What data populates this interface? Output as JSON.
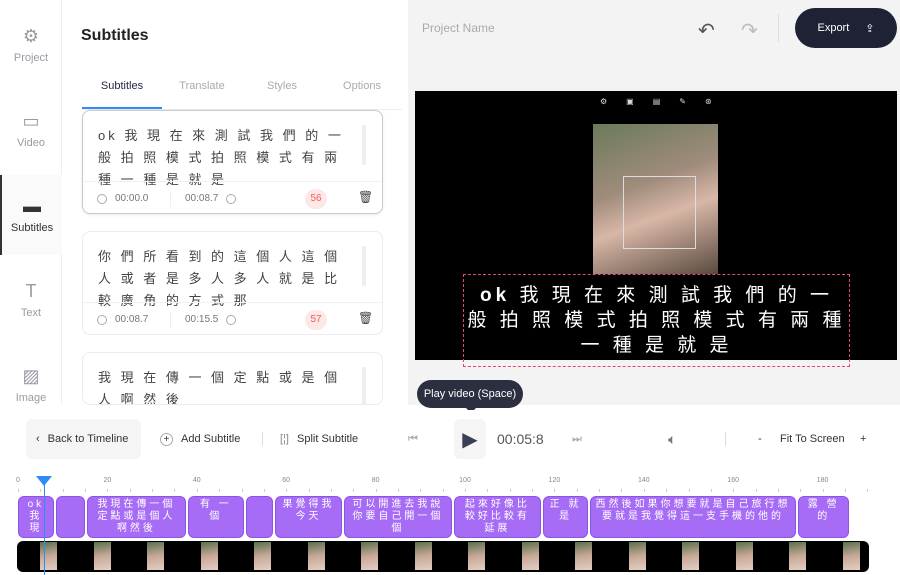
{
  "sidebar": {
    "items": [
      {
        "label": "Project",
        "icon": "gear-icon"
      },
      {
        "label": "Video",
        "icon": "video-icon"
      },
      {
        "label": "Subtitles",
        "icon": "subtitles-icon",
        "active": true
      },
      {
        "label": "Text",
        "icon": "text-icon"
      },
      {
        "label": "Image",
        "icon": "image-icon"
      }
    ]
  },
  "panel": {
    "title": "Subtitles",
    "tabs": [
      "Subtitles",
      "Translate",
      "Styles",
      "Options"
    ],
    "cards": [
      {
        "text": "ok 我 現 在 來 測 試 我 們 的 一 般 拍 照 模 式 拍 照 模 式 有 兩 種 一 種 是 就 是",
        "start": "00:00.0",
        "end": "00:08.7",
        "count": "56"
      },
      {
        "text": "你 們 所 看 到 的 這 個 人 這 個 人 或 者 是 多 人 多 人 就 是 比 較 廣 角 的 方 式 那",
        "start": "00:08.7",
        "end": "00:15.5",
        "count": "57"
      },
      {
        "text": "我 現 在 傳 一 個 定 點 或 是 個 人 啊 然 後",
        "start": "",
        "end": "",
        "count": ""
      }
    ]
  },
  "header": {
    "project_name": "Project Name",
    "export_label": "Export"
  },
  "video": {
    "subtitle_bold": "ok",
    "subtitle": " 我 現 在 來 測 試 我 們 的 一 般 拍 照 模 式 拍 照 模 式 有 兩 種 一 種 是 就 是"
  },
  "tooltip": "Play video (Space)",
  "controls": {
    "back": "Back to Timeline",
    "add": "Add Subtitle",
    "split": "Split Subtitle",
    "time": "00:05:8",
    "zoom_minus": "-",
    "fit": "Fit To Screen",
    "zoom_plus": "+"
  },
  "timeline": {
    "ticks": [
      "0",
      "20",
      "40",
      "60",
      "80",
      "100",
      "120",
      "140",
      "160",
      "180"
    ],
    "playhead": 5.8,
    "blocks": [
      {
        "text": "ok 我 現",
        "start": 0,
        "end": 8
      },
      {
        "text": "",
        "start": 8.5,
        "end": 15
      },
      {
        "text": "我現在傳一個定點或是個人啊然後",
        "start": 15.5,
        "end": 37.5
      },
      {
        "text": "有 一 個",
        "start": 38,
        "end": 50.5
      },
      {
        "text": "",
        "start": 51,
        "end": 57
      },
      {
        "text": "果覺得我今天",
        "start": 57.5,
        "end": 72.5
      },
      {
        "text": "可以開進去我說你要自己開一個個",
        "start": 73,
        "end": 97
      },
      {
        "text": "起來好像比較好比較有延展",
        "start": 97.5,
        "end": 117
      },
      {
        "text": "正 就 是",
        "start": 117.5,
        "end": 127.5
      },
      {
        "text": "西然後如果你想要就是自己旅行想要就是我覺得這一支手機的他的",
        "start": 128,
        "end": 174
      },
      {
        "text": "露 營 的",
        "start": 174.5,
        "end": 186
      }
    ]
  }
}
